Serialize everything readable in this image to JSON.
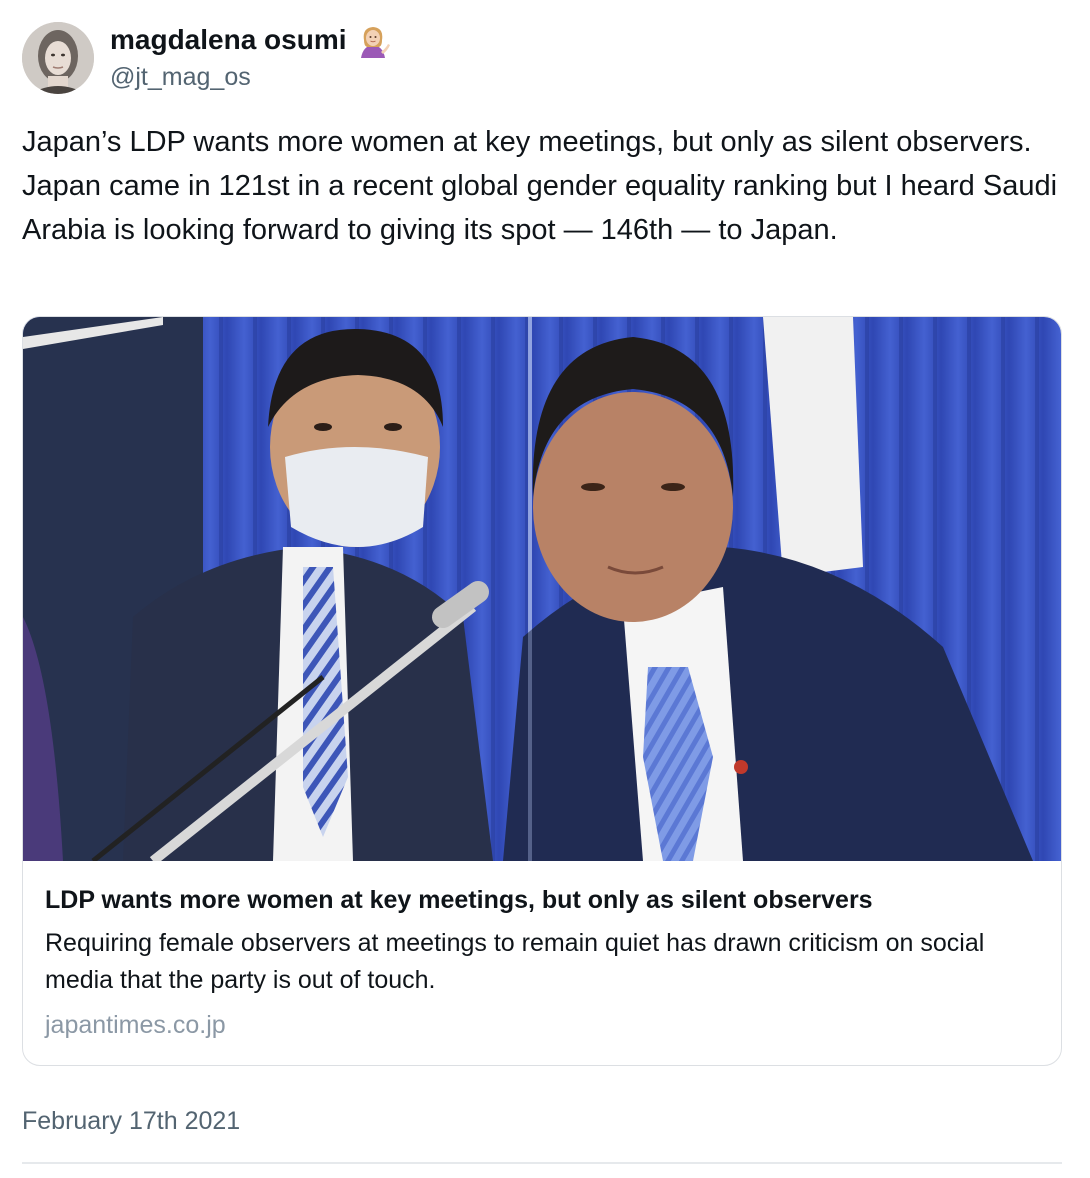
{
  "author": {
    "display_name": "magdalena osumi",
    "emoji": "💁🏼‍♀️",
    "emoji_icon": "woman-tipping-hand-icon",
    "handle": "@jt_mag_os"
  },
  "tweet": {
    "text": "Japan’s LDP wants more women at key meetings, but only as silent observers. Japan came in 121st in a recent global gender equality ranking but I heard Saudi Arabia is looking forward to giving its spot — 146th — to Japan.",
    "date": "February 17th 2021"
  },
  "link_card": {
    "title": "LDP wants more women at key meetings, but only as silent observers",
    "description": "Requiring female observers at meetings to remain quiet has drawn criticism on social media that the party is out of touch.",
    "domain": "japantimes.co.jp"
  },
  "colors": {
    "text_primary": "#0f1419",
    "text_secondary": "#536471",
    "domain_gray": "#8b98a5",
    "card_border": "#dcdfe3",
    "curtain_blue": "#3d55c4"
  }
}
